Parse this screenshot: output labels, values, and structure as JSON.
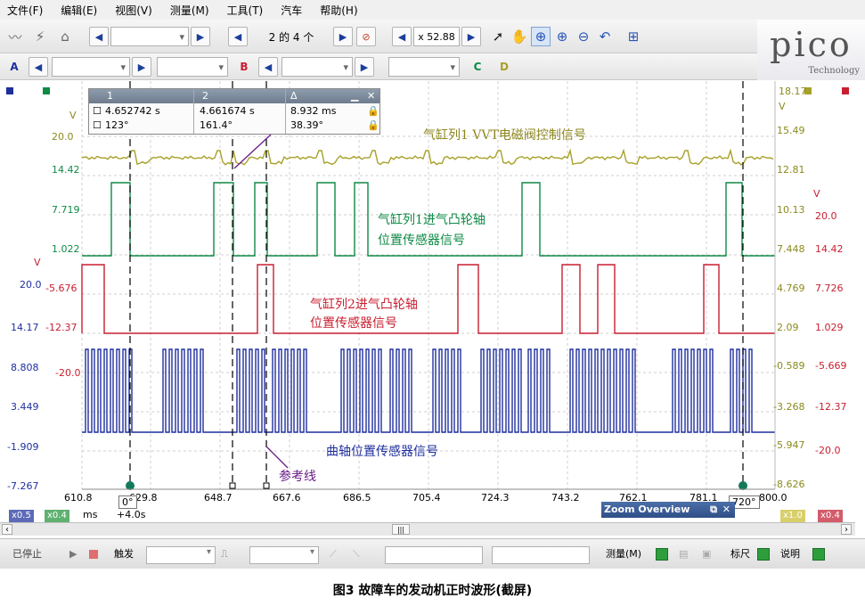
{
  "menu": [
    "文件(F)",
    "编辑(E)",
    "视图(V)",
    "测量(M)",
    "工具(T)",
    "汽车",
    "帮助(H)"
  ],
  "toolbar": {
    "waveform_nav": "2 的 4 个",
    "zoom_value": "x 52.88",
    "channel_a": "A",
    "channel_b": "B",
    "channel_c": "C",
    "channel_d": "D"
  },
  "logo": {
    "brand": "pico",
    "sub": "Technology"
  },
  "rulers": {
    "col1": "1",
    "col2": "2",
    "col3": "Δ",
    "time1": "4.652742 s",
    "time2": "4.661674 s",
    "time_delta": "8.932 ms",
    "angle1": "123°",
    "angle2": "161.4°",
    "angle_delta": "38.39°"
  },
  "left_axis": {
    "olive_unit": "V",
    "olive_ticks": [
      "20.0",
      "14.42",
      "7.719",
      "1.022"
    ],
    "red_unit": "V",
    "red_ticks": [
      "20.0",
      "14.17"
    ],
    "red_inner_ticks": [
      "-5.676",
      "-12.37",
      "-20.0"
    ],
    "blue_ticks": [
      "8.808",
      "3.449",
      "-1.909",
      "-7.267"
    ]
  },
  "right_axis": {
    "olive_ticks": [
      "18.17",
      "V",
      "15.49",
      "12.81",
      "10.13",
      "7.448",
      "4.769",
      "2.09",
      "-0.589",
      "-3.268",
      "-5.947",
      "-8.626"
    ],
    "red_unit": "V",
    "red_ticks": [
      "20.0",
      "14.42",
      "7.726",
      "1.029",
      "-5.669",
      "-12.37",
      "-20.0"
    ]
  },
  "time_axis": {
    "ticks": [
      "610.8",
      "629.8",
      "648.7",
      "667.6",
      "686.5",
      "705.4",
      "724.3",
      "743.2",
      "762.1",
      "781.1",
      "800.0"
    ],
    "unit": "ms",
    "offset": "+4.0s",
    "zoom_x_left": "x0.5",
    "zoom_x_left2": "x0.4",
    "zoom_x_right": "x1.0",
    "zoom_x_right2": "x0.4",
    "angle_start": "0°",
    "angle_end": "720°"
  },
  "annotations": {
    "vvt": "气缸列1 VVT电磁阀控制信号",
    "cam1_line1": "气缸列1进气凸轮轴",
    "cam1_line2": "位置传感器信号",
    "cam2_line1": "气缸列2进气凸轮轴",
    "cam2_line2": "位置传感器信号",
    "crank": "曲轴位置传感器信号",
    "ref": "参考线"
  },
  "zoom_overview": {
    "title": "Zoom Overview"
  },
  "status": {
    "stopped": "已停止",
    "trigger": "触发",
    "measure": "测量(M)",
    "ruler": "标尺",
    "notes": "说明"
  },
  "caption": "图3    故障车的发动机正时波形(截屏)",
  "colors": {
    "blue": "#1f2f9e",
    "green": "#0e8a45",
    "red": "#c71f30",
    "olive": "#a8a128",
    "purple": "#6a1b8a"
  }
}
